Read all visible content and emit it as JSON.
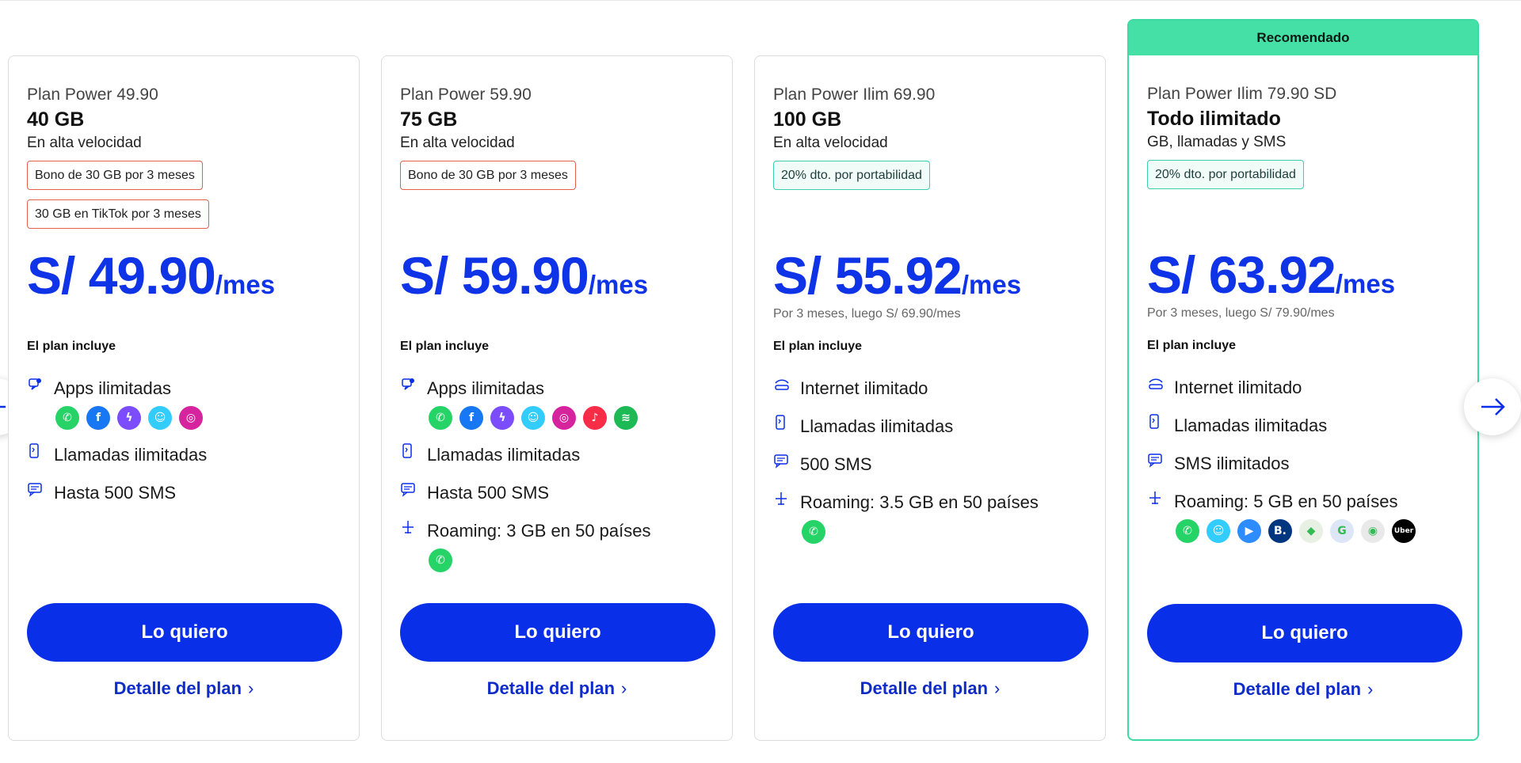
{
  "recommended_label": "Recomendado",
  "common": {
    "includes_label": "El plan incluye",
    "cta_label": "Lo quiero",
    "detail_label": "Detalle del plan"
  },
  "plans": [
    {
      "name": "Plan Power 49.90",
      "data": "40 GB",
      "subtitle": "En alta velocidad",
      "badges": [
        "Bono de 30 GB por 3 meses",
        "30 GB en TikTok por 3 meses"
      ],
      "price": "S/ 49.90",
      "per": "/mes",
      "note": "",
      "features": [
        {
          "icon": "apps-icon",
          "label": "Apps ilimitadas",
          "apps": [
            "whatsapp",
            "facebook",
            "messenger",
            "waze",
            "instagram"
          ]
        },
        {
          "icon": "phone-icon",
          "label": "Llamadas ilimitadas"
        },
        {
          "icon": "sms-icon",
          "label": "Hasta 500 SMS"
        }
      ]
    },
    {
      "name": "Plan Power 59.90",
      "data": "75 GB",
      "subtitle": "En alta velocidad",
      "badges": [
        "Bono de 30 GB por 3 meses"
      ],
      "price": "S/ 59.90",
      "per": "/mes",
      "note": "",
      "features": [
        {
          "icon": "apps-icon",
          "label": "Apps ilimitadas",
          "apps": [
            "whatsapp",
            "facebook",
            "messenger",
            "waze",
            "instagram",
            "apple-music",
            "spotify"
          ]
        },
        {
          "icon": "phone-icon",
          "label": "Llamadas ilimitadas"
        },
        {
          "icon": "sms-icon",
          "label": "Hasta 500 SMS"
        },
        {
          "icon": "plane-icon",
          "label": "Roaming: 3 GB en 50 países",
          "apps": [
            "whatsapp"
          ]
        }
      ]
    },
    {
      "name": "Plan Power Ilim 69.90",
      "data": "100 GB",
      "subtitle": "En alta velocidad",
      "badges": [
        "20% dto. por portabilidad"
      ],
      "price": "S/ 55.92",
      "per": "/mes",
      "note": "Por 3 meses, luego S/ 69.90/mes",
      "features": [
        {
          "icon": "internet-icon",
          "label": "Internet ilimitado"
        },
        {
          "icon": "phone-icon",
          "label": "Llamadas ilimitadas"
        },
        {
          "icon": "sms-icon",
          "label": "500 SMS"
        },
        {
          "icon": "plane-icon",
          "label": "Roaming: 3.5 GB en 50 países",
          "apps": [
            "whatsapp"
          ]
        }
      ]
    },
    {
      "name": "Plan Power Ilim 79.90 SD",
      "data": "Todo ilimitado",
      "subtitle": "GB, llamadas y SMS",
      "badges": [
        "20% dto. por portabilidad"
      ],
      "price": "S/ 63.92",
      "per": "/mes",
      "note": "Por 3 meses, luego S/ 79.90/mes",
      "recommended": true,
      "features": [
        {
          "icon": "internet-icon",
          "label": "Internet ilimitado"
        },
        {
          "icon": "phone-icon",
          "label": "Llamadas ilimitadas"
        },
        {
          "icon": "sms-icon",
          "label": "SMS ilimitados"
        },
        {
          "icon": "plane-icon",
          "label": "Roaming: 5 GB en 50 países",
          "apps": [
            "whatsapp",
            "waze",
            "zoom",
            "booking",
            "google-maps",
            "google-translate",
            "tripadvisor",
            "uber"
          ]
        }
      ]
    }
  ],
  "app_icons": {
    "whatsapp": {
      "color": "#25d366",
      "glyph": "✆"
    },
    "facebook": {
      "color": "#1877f2",
      "glyph": "f"
    },
    "messenger": {
      "color": "#7b4dff",
      "glyph": "ϟ"
    },
    "waze": {
      "color": "#33ccff",
      "glyph": "☺"
    },
    "instagram": {
      "color": "#d6249f",
      "glyph": "◎"
    },
    "apple-music": {
      "color": "#fa2d48",
      "glyph": "♪"
    },
    "spotify": {
      "color": "#1db954",
      "glyph": "≋"
    },
    "zoom": {
      "color": "#2d8cff",
      "glyph": "▶"
    },
    "booking": {
      "color": "#003580",
      "glyph": "B."
    },
    "google-maps": {
      "color": "#e8f0e4",
      "glyph": "◆"
    },
    "google-translate": {
      "color": "#dde6f7",
      "glyph": "G"
    },
    "tripadvisor": {
      "color": "#e9e9e9",
      "glyph": "◉"
    },
    "uber": {
      "color": "#000000",
      "glyph": "Uber"
    }
  },
  "colors": {
    "brand_blue": "#0a2fe8",
    "recommended_green": "#44e0a6",
    "badge_red": "#e0624a",
    "badge_teal": "#3fcfb0"
  }
}
